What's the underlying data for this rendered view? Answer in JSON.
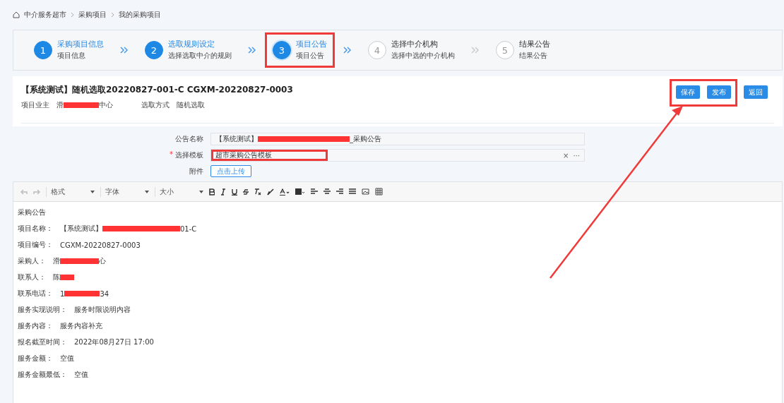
{
  "breadcrumb": [
    "中介服务超市",
    "采购项目",
    "我的采购项目"
  ],
  "steps": [
    {
      "number": "1",
      "title": "采购项目信息",
      "subtitle": "项目信息",
      "done": true,
      "selected": false,
      "highlighted": false
    },
    {
      "number": "2",
      "title": "选取规则设定",
      "subtitle": "选择选取中介的规则",
      "done": true,
      "selected": false,
      "highlighted": false
    },
    {
      "number": "3",
      "title": "项目公告",
      "subtitle": "项目公告",
      "done": false,
      "selected": true,
      "highlighted": true
    },
    {
      "number": "4",
      "title": "选择中介机构",
      "subtitle": "选择中选的中介机构",
      "done": false,
      "selected": false,
      "highlighted": false
    },
    {
      "number": "5",
      "title": "结果公告",
      "subtitle": "结果公告",
      "done": false,
      "selected": false,
      "highlighted": false
    }
  ],
  "header": {
    "title": "【系统测试】随机选取20220827-001-C CGXM-20220827-0003",
    "meta": [
      {
        "label": "项目业主",
        "value_start": "滑",
        "value_end": "中心",
        "redacted": true
      },
      {
        "label": "选取方式",
        "value_start": "随机选取",
        "redacted": false
      }
    ],
    "buttons": [
      {
        "label": "保存",
        "highlighted": true
      },
      {
        "label": "发布",
        "highlighted": true
      },
      {
        "label": "返回",
        "highlighted": false
      }
    ]
  },
  "form": {
    "name": {
      "label": "公告名称",
      "value_start": "【系统测试】",
      "value_end": "_采购公告",
      "redacted": true
    },
    "template": {
      "label": "选择模板",
      "required_mark": "*",
      "value": "超市采购公告模板",
      "highlighted": true,
      "clear": "×",
      "more": "···"
    },
    "attachment": {
      "label": "附件",
      "button": "点击上传"
    }
  },
  "toolbar": {
    "format": "格式",
    "font": "字体",
    "size": "大小"
  },
  "body": [
    {
      "label": "采购公告",
      "redacted": false
    },
    {
      "label": "项目名称：",
      "value_start": "【系统测试】",
      "value_end": "01-C",
      "redacted": true
    },
    {
      "label": "项目编号：",
      "value_start": "CGXM-20220827-0003",
      "redacted": false
    },
    {
      "label": "采购人：",
      "value_start": "滑",
      "value_end": "心",
      "redacted": true
    },
    {
      "label": "联系人：",
      "value_start": "陈",
      "redacted": true
    },
    {
      "label": "联系电话：",
      "value_start": "1",
      "value_end": "34",
      "redacted": true
    },
    {
      "label": "服务实现说明：",
      "value_start": "服务时限说明内容",
      "redacted": false
    },
    {
      "label": "服务内容：",
      "value_start": "服务内容补充",
      "redacted": false
    },
    {
      "label": "报名截至时间：",
      "value_start": "2022年08月27日 17:00",
      "redacted": false
    },
    {
      "label": "服务金额：",
      "value_start": "空值",
      "redacted": false
    },
    {
      "label": "服务金额最低：",
      "value_start": "空值",
      "redacted": false
    }
  ]
}
